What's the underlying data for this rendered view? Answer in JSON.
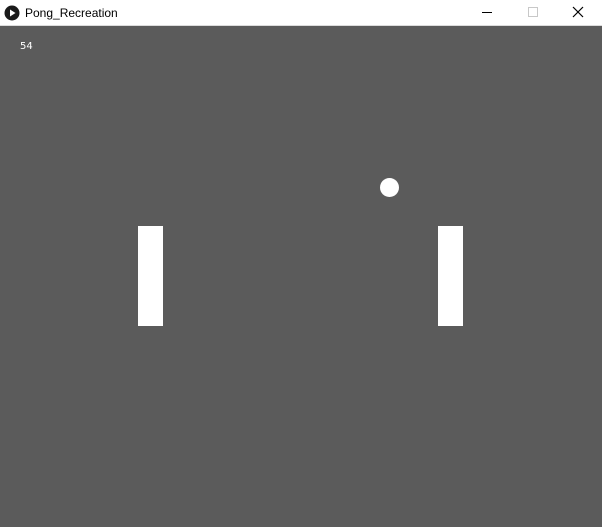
{
  "window": {
    "title": "Pong_Recreation",
    "icons": {
      "app": "processing-play-icon",
      "minimize": "minimize-icon",
      "maximize": "maximize-icon",
      "close": "close-icon"
    }
  },
  "game": {
    "score": "54",
    "colors": {
      "background": "#5b5b5b",
      "foreground": "#ffffff"
    }
  }
}
